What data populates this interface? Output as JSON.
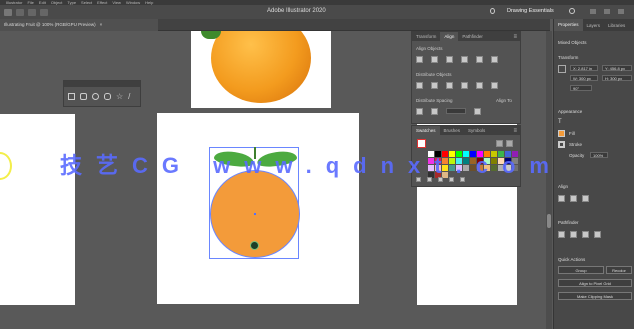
{
  "menubar": [
    "Illustrator",
    "File",
    "Edit",
    "Object",
    "Type",
    "Select",
    "Effect",
    "View",
    "Window",
    "Help"
  ],
  "app_title": "Adobe Illustrator 2020",
  "workspace": "Drawing Essentials",
  "doc_tab": "Illustrating Fruit @ 100% (RGB/GPU Preview)",
  "transform_panel": {
    "tabs": [
      "Transform",
      "Align",
      "Pathfinder"
    ],
    "align_objects": "Align Objects",
    "distribute_objects": "Distribute Objects",
    "distribute_spacing": "Distribute Spacing",
    "align_to": "Align To"
  },
  "swatches_panel": {
    "tabs": [
      "Swatches",
      "Brushes",
      "Symbols"
    ]
  },
  "right_panel": {
    "tabs": [
      "Properties",
      "Layers",
      "Libraries"
    ],
    "selection": "Mixed Objects",
    "transform": "Transform",
    "x": "X: 2.817 in",
    "w": "W: 300 px",
    "h": "H: 300 px",
    "y": "Y: 456.8 px",
    "angle": "90°",
    "appearance": "Appearance",
    "fill": "Fill",
    "stroke": "Stroke",
    "opacity": "Opacity",
    "opacity_value": "100%",
    "align": "Align",
    "pathfinder": "Pathfinder",
    "quick_actions": "Quick Actions",
    "group_btn": "Group",
    "recolor_btn": "Recolor",
    "align_grid_btn": "Align to Pixel Grid",
    "clip_btn": "Make Clipping Mask"
  },
  "watermark": "技艺CG www.qdnxt.com",
  "colors": {
    "orange": "#f39b3a",
    "leaf": "#4caa40",
    "selection": "#4f6fff"
  },
  "icons": [
    "home-icon",
    "lightbulb-icon",
    "search-icon",
    "rectangle-icon",
    "ellipse-icon",
    "star-icon"
  ]
}
